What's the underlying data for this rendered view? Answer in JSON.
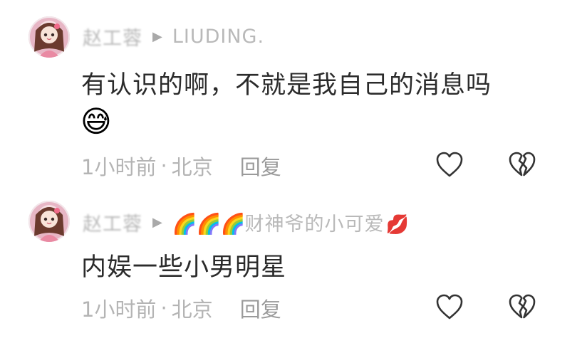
{
  "comments": [
    {
      "username": "赵工蓉",
      "reply_to": "LIUDING.",
      "text": "有认识的啊，不就是我自己的消息吗",
      "emoji": "😅",
      "time": "1小时前",
      "location": "北京",
      "reply_label": "回复",
      "separator": "·"
    },
    {
      "username": "赵工蓉",
      "reply_to_emoji": "🌈",
      "reply_to_text": "财神爷的小可爱",
      "reply_to_suffix_emoji": "💋",
      "text": "内娱一些小男明星",
      "time": "1小时前",
      "location": "北京",
      "reply_label": "回复",
      "separator": "·"
    }
  ],
  "icons": {
    "arrow": "reply-arrow-icon",
    "like": "heart-outline-icon",
    "dislike": "broken-heart-outline-icon"
  },
  "colors": {
    "primary_text": "#2b2b2b",
    "secondary_text": "#b4b4b4",
    "icon": "#333333"
  }
}
